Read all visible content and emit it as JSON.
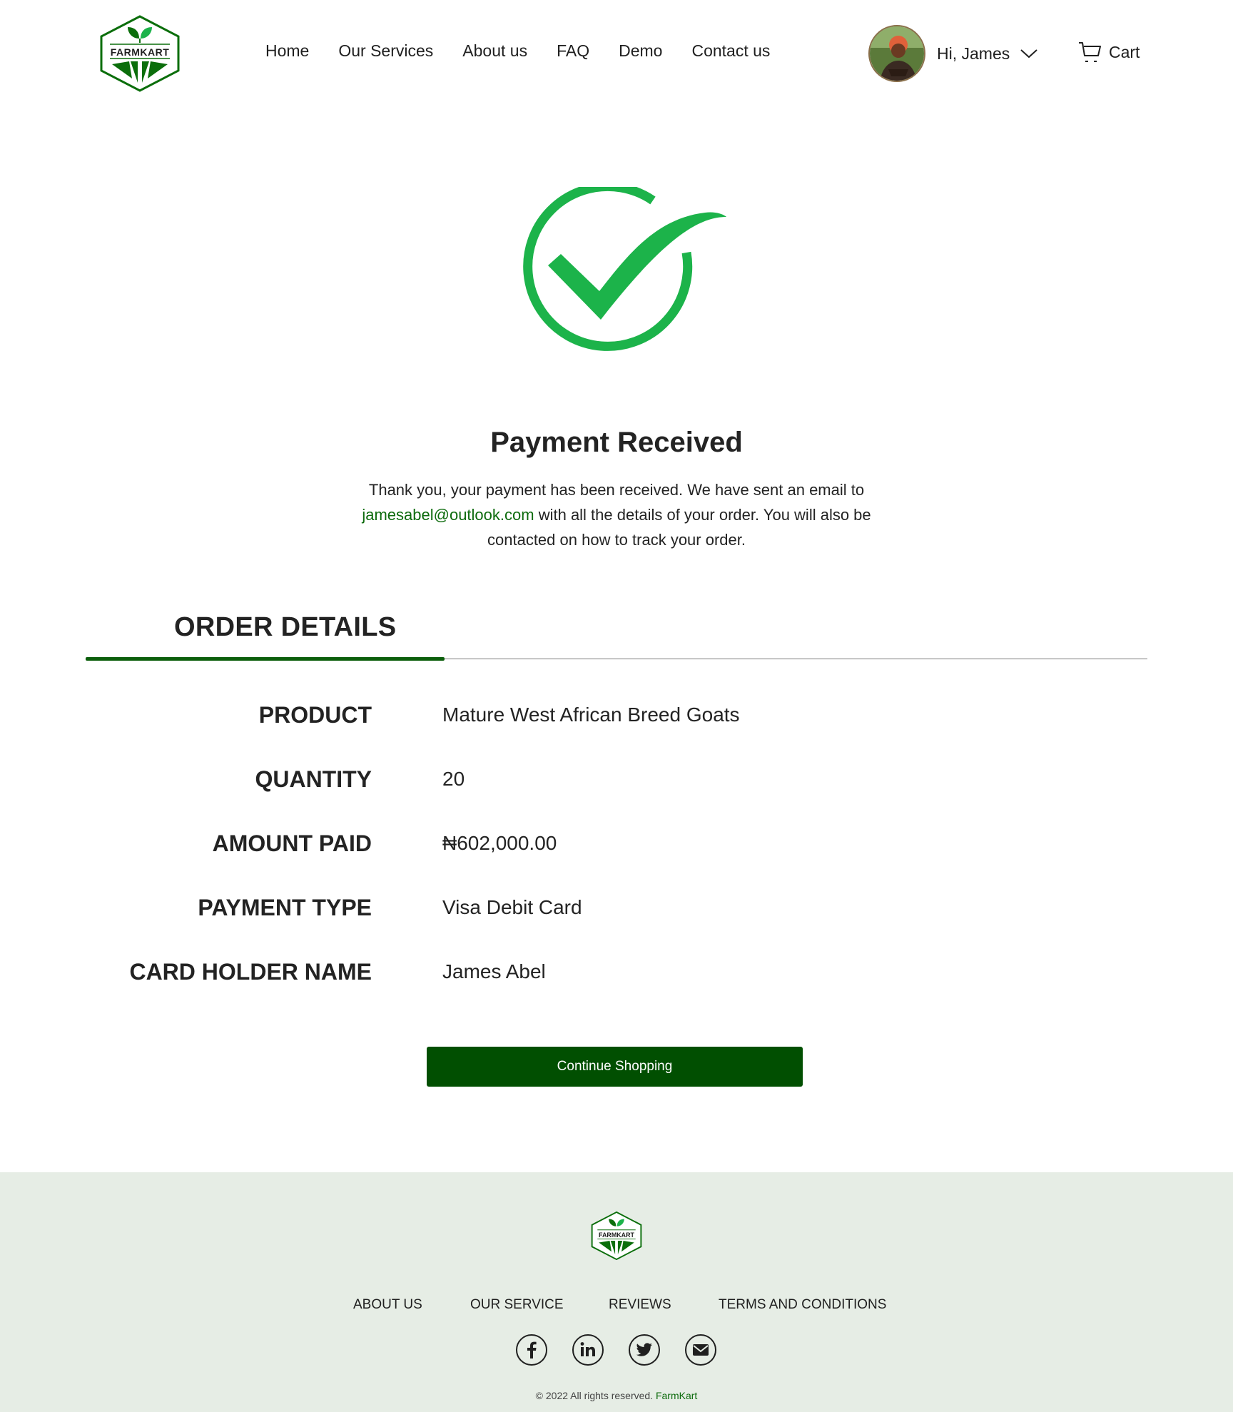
{
  "brand": {
    "name": "FarmKart",
    "logo_text": "FARMKART",
    "colors": {
      "primary": "#014f01",
      "accent_green": "#1cb34a",
      "link": "#0d6b0d",
      "footer_bg": "#e6ede5"
    }
  },
  "header": {
    "nav": [
      "Home",
      "Our Services",
      "About us",
      "FAQ",
      "Demo",
      "Contact us"
    ],
    "user_greeting": "Hi, James",
    "cart_label": "Cart"
  },
  "hero": {
    "icon": "check-circle-icon",
    "title": "Payment Received",
    "message_before": "Thank you, your payment has been received. We have sent an email to",
    "email": "jamesabel@outlook.com",
    "message_after": "with all the details of your order. You will also be contacted on how to track your order."
  },
  "order": {
    "heading": "ORDER DETAILS",
    "rows": [
      {
        "label": "PRODUCT",
        "value": "Mature West African Breed Goats"
      },
      {
        "label": "QUANTITY",
        "value": "20"
      },
      {
        "label": "AMOUNT PAID",
        "value": "₦602,000.00"
      },
      {
        "label": "PAYMENT TYPE",
        "value": "Visa Debit Card"
      },
      {
        "label": "CARD HOLDER NAME",
        "value": "James Abel"
      }
    ],
    "button_label": "Continue Shopping"
  },
  "footer": {
    "links": [
      "ABOUT US",
      "OUR SERVICE",
      "REVIEWS",
      "TERMS AND CONDITIONS"
    ],
    "socials": [
      "facebook-icon",
      "linkedin-icon",
      "twitter-icon",
      "email-icon"
    ],
    "copyright_prefix": "© 2022 All rights reserved.",
    "copyright_brand": "FarmKart"
  }
}
